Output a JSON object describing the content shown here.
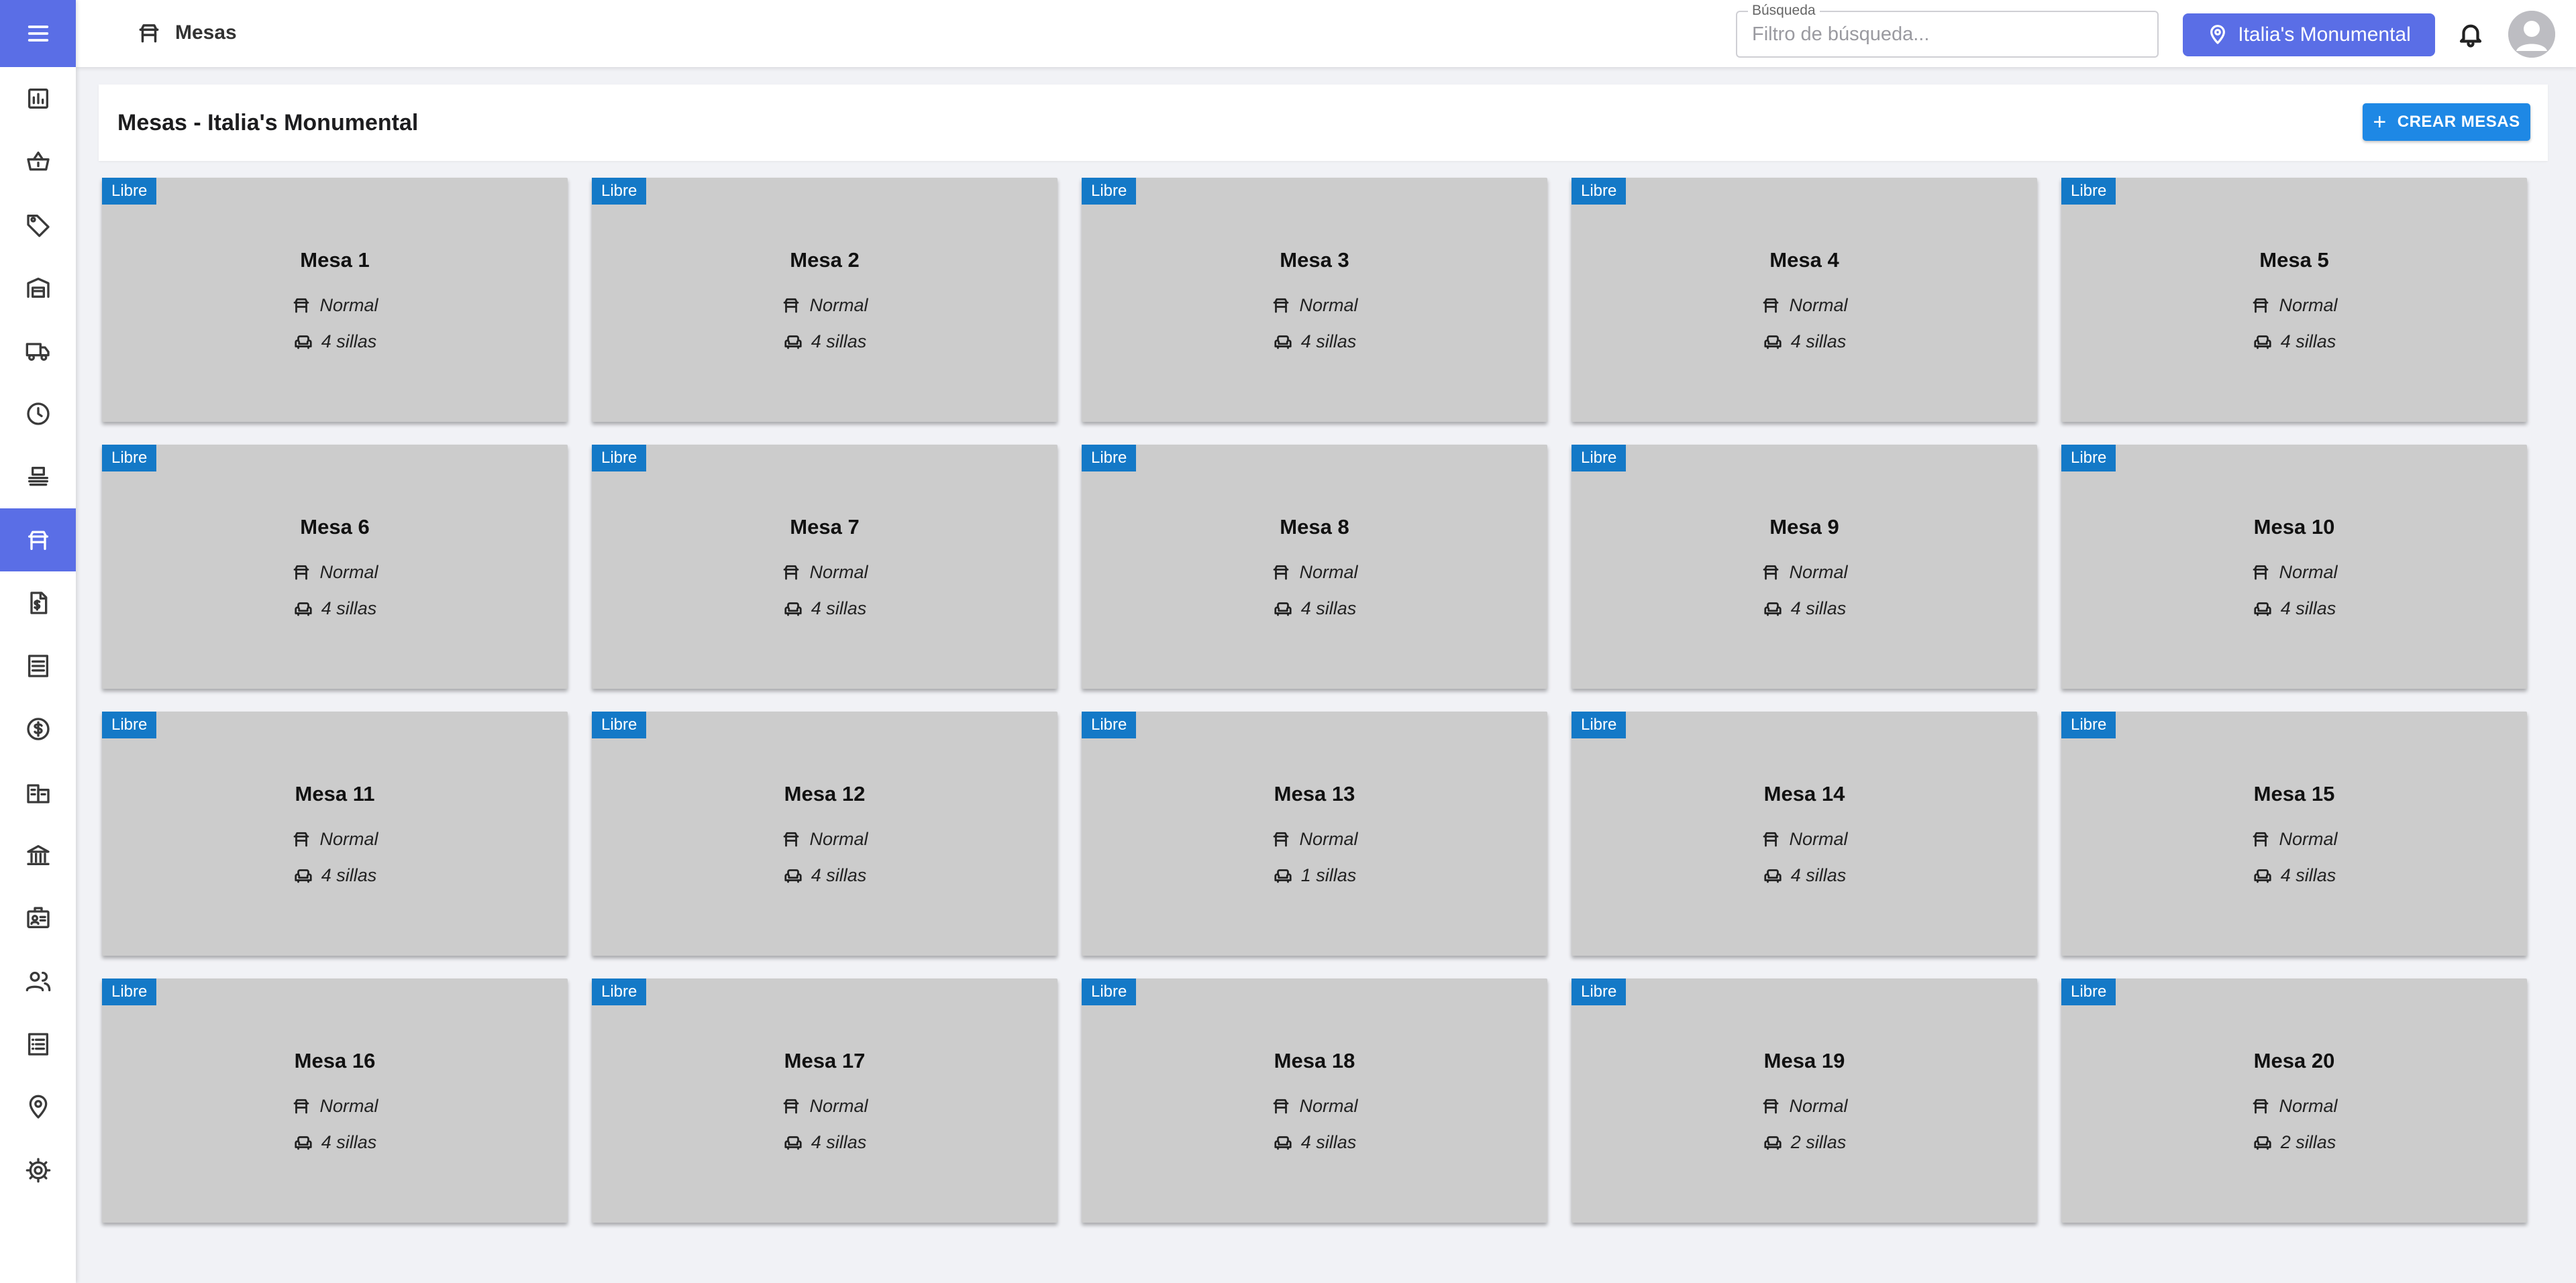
{
  "topbar": {
    "title": "Mesas",
    "search_label": "Búsqueda",
    "search_placeholder": "Filtro de búsqueda...",
    "search_value": "",
    "location_label": "Italia's Monumental"
  },
  "sidebar": {
    "items": [
      {
        "icon": "chart-icon"
      },
      {
        "icon": "basket-icon"
      },
      {
        "icon": "tag-icon"
      },
      {
        "icon": "warehouse-icon"
      },
      {
        "icon": "truck-icon"
      },
      {
        "icon": "clock-icon"
      },
      {
        "icon": "stack-icon"
      },
      {
        "icon": "table-icon",
        "active": true
      },
      {
        "icon": "invoice-icon"
      },
      {
        "icon": "list-icon"
      },
      {
        "icon": "dollar-icon"
      },
      {
        "icon": "buildings-icon"
      },
      {
        "icon": "bank-icon"
      },
      {
        "icon": "badge-icon"
      },
      {
        "icon": "users-icon"
      },
      {
        "icon": "checklist-icon"
      },
      {
        "icon": "location-icon"
      },
      {
        "icon": "gear-icon"
      }
    ]
  },
  "content": {
    "page_title": "Mesas - Italia's Monumental",
    "create_label": "CREAR MESAS"
  },
  "tables": [
    {
      "status": "Libre",
      "name": "Mesa 1",
      "type": "Normal",
      "seats": "4 sillas"
    },
    {
      "status": "Libre",
      "name": "Mesa 2",
      "type": "Normal",
      "seats": "4 sillas"
    },
    {
      "status": "Libre",
      "name": "Mesa 3",
      "type": "Normal",
      "seats": "4 sillas"
    },
    {
      "status": "Libre",
      "name": "Mesa 4",
      "type": "Normal",
      "seats": "4 sillas"
    },
    {
      "status": "Libre",
      "name": "Mesa 5",
      "type": "Normal",
      "seats": "4 sillas"
    },
    {
      "status": "Libre",
      "name": "Mesa 6",
      "type": "Normal",
      "seats": "4 sillas"
    },
    {
      "status": "Libre",
      "name": "Mesa 7",
      "type": "Normal",
      "seats": "4 sillas"
    },
    {
      "status": "Libre",
      "name": "Mesa 8",
      "type": "Normal",
      "seats": "4 sillas"
    },
    {
      "status": "Libre",
      "name": "Mesa 9",
      "type": "Normal",
      "seats": "4 sillas"
    },
    {
      "status": "Libre",
      "name": "Mesa 10",
      "type": "Normal",
      "seats": "4 sillas"
    },
    {
      "status": "Libre",
      "name": "Mesa 11",
      "type": "Normal",
      "seats": "4 sillas"
    },
    {
      "status": "Libre",
      "name": "Mesa 12",
      "type": "Normal",
      "seats": "4 sillas"
    },
    {
      "status": "Libre",
      "name": "Mesa 13",
      "type": "Normal",
      "seats": "1 sillas"
    },
    {
      "status": "Libre",
      "name": "Mesa 14",
      "type": "Normal",
      "seats": "4 sillas"
    },
    {
      "status": "Libre",
      "name": "Mesa 15",
      "type": "Normal",
      "seats": "4 sillas"
    },
    {
      "status": "Libre",
      "name": "Mesa 16",
      "type": "Normal",
      "seats": "4 sillas"
    },
    {
      "status": "Libre",
      "name": "Mesa 17",
      "type": "Normal",
      "seats": "4 sillas"
    },
    {
      "status": "Libre",
      "name": "Mesa 18",
      "type": "Normal",
      "seats": "4 sillas"
    },
    {
      "status": "Libre",
      "name": "Mesa 19",
      "type": "Normal",
      "seats": "2 sillas"
    },
    {
      "status": "Libre",
      "name": "Mesa 20",
      "type": "Normal",
      "seats": "2 sillas"
    }
  ],
  "colors": {
    "accent": "#5a6ee6",
    "badge": "#1479c7",
    "create_button": "#1e88e5",
    "card_bg": "#cccccc"
  }
}
